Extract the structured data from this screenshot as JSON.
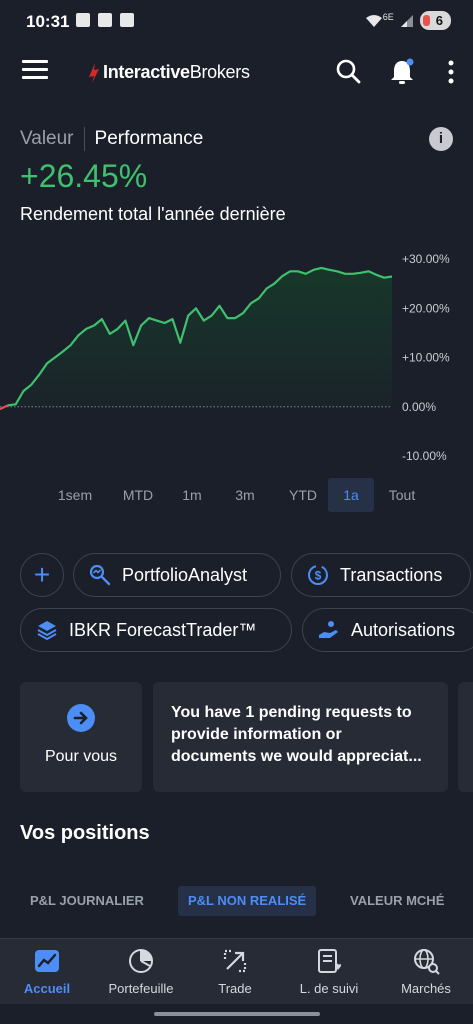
{
  "status": {
    "time": "10:31",
    "battery": "6",
    "network": "6E"
  },
  "header": {
    "logo_part1": "Interactive",
    "logo_part2": "Brokers",
    "icons": [
      "menu-icon",
      "search-icon",
      "bell-icon",
      "more-icon"
    ]
  },
  "performance": {
    "tab_valeur": "Valeur",
    "tab_performance": "Performance",
    "info_symbol": "i",
    "value": "+26.45%",
    "subtitle": "Rendement total l'année dernière"
  },
  "chart_data": {
    "type": "area",
    "y_ticks": [
      "+30.00%",
      "+20.00%",
      "+10.00%",
      "0.00%",
      "-10.00%"
    ],
    "ylim": [
      -10,
      30
    ],
    "baseline": 0,
    "x": [
      0,
      2,
      4,
      6,
      8,
      10,
      12,
      14,
      16,
      18,
      20,
      22,
      24,
      26,
      28,
      30,
      32,
      34,
      36,
      38,
      40,
      42,
      44,
      46,
      48,
      50,
      52,
      54,
      56,
      58,
      60,
      62,
      64,
      66,
      68,
      70,
      72,
      74,
      76,
      78,
      80,
      82,
      84,
      86,
      88,
      90,
      92,
      94,
      96,
      98,
      100
    ],
    "values": [
      -0.5,
      0.3,
      0.5,
      3.2,
      4.5,
      6.5,
      8.8,
      10.0,
      11.2,
      12.5,
      14.5,
      15.8,
      16.5,
      17.8,
      14.8,
      15.8,
      17.5,
      12.5,
      16.5,
      18.0,
      17.5,
      17.0,
      17.8,
      13.0,
      18.5,
      20.0,
      17.5,
      18.5,
      20.5,
      18.0,
      18.0,
      19.0,
      21.0,
      22.0,
      24.0,
      25.0,
      26.5,
      27.5,
      27.5,
      27.0,
      27.8,
      28.2,
      27.8,
      27.5,
      27.0,
      27.0,
      27.2,
      27.5,
      26.8,
      26.2,
      26.45
    ],
    "colors": {
      "positive": "#3fc06f",
      "negative": "#e05252",
      "fill": "#17392a"
    },
    "grid": false
  },
  "periods": {
    "items": [
      "1sem",
      "MTD",
      "1m",
      "3m",
      "YTD",
      "1a",
      "Tout"
    ],
    "active": "1a"
  },
  "shortcuts": {
    "add_symbol": "+",
    "portfolio_analyst": "PortfolioAnalyst",
    "transactions": "Transactions",
    "forecast_trader": "IBKR ForecastTrader™",
    "autorisations": "Autorisations"
  },
  "cards": {
    "for_you": "Pour vous",
    "request_message": "You have 1 pending requests to provide information or documents we would appreciat..."
  },
  "positions": {
    "title": "Vos positions",
    "tabs": [
      "P&L JOURNALIER",
      "P&L NON REALISÉ",
      "VALEUR MCHÉ"
    ],
    "active_tab": "P&L NON REALISÉ"
  },
  "bottom_nav": {
    "items": [
      "Accueil",
      "Portefeuille",
      "Trade",
      "L. de suivi",
      "Marchés"
    ],
    "active": "Accueil"
  },
  "colors": {
    "background": "#1b1f29",
    "accent": "#4c8df6",
    "green": "#3fc06f",
    "card": "#262b36"
  }
}
